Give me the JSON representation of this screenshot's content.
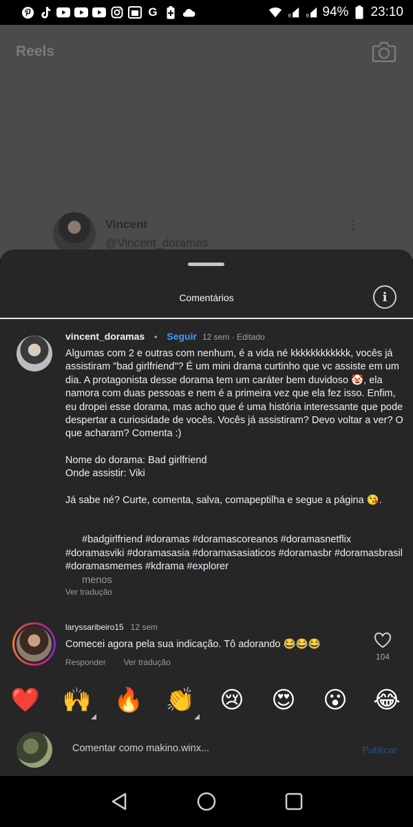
{
  "status_bar": {
    "icons": [
      "pinterest-icon",
      "tiktok-icon",
      "youtube-icon",
      "youtube-icon",
      "youtube-icon",
      "instagram-icon",
      "vpn-icon",
      "google-icon",
      "battery-saver-icon",
      "cloud-icon"
    ],
    "battery": "94%",
    "time": "23:10"
  },
  "background": {
    "title": "Reels",
    "profile_name": "Vincent",
    "profile_handle": "@Vincent_doramas"
  },
  "sheet": {
    "title": "Comentários"
  },
  "caption": {
    "username": "vincent_doramas",
    "follow_label": "Seguir",
    "meta": "12 sem · Editado",
    "paragraph1": "Algumas com 2 e outras com nenhum, é a vida né kkkkkkkkkkkk, vocês já assistiram \"bad girlfriend\"? É um mini drama curtinho que vc assiste em um dia. A protagonista desse dorama tem um caráter bem duvidoso 🤡, ela namora com duas pessoas e nem é a primeira vez que ela fez isso. Enfim, eu dropei esse dorama, mas acho que é uma história interessante que pode despertar a curiosidade de vocês. Vocês já assistiram? Devo voltar a ver? O que acharam? Comenta :)",
    "paragraph2": "Nome do dorama: Bad girlfriend\nOnde assistir: Viki",
    "paragraph3": "Já sabe né? Curte, comenta, salva, comapeptilha e segue a página 😘.",
    "hashtags": "#badgirlfriend #doramas #doramascoreanos #doramasnetflix #doramasviki #doramasasia #doramasasiaticos #doramasbr #doramasbrasil #doramasmemes #kdrama #explorer",
    "less_label": "menos",
    "see_translation": "Ver tradução"
  },
  "comment": {
    "username": "laryssaribeiro15",
    "time": "12 sem",
    "text": "Comecei agora  pela sua indicação. Tô adorando 😂😂😂",
    "reply_label": "Responder",
    "see_translation": "Ver tradução",
    "likes": "104"
  },
  "emoji_bar": [
    "❤️",
    "🙌",
    "🔥",
    "👏",
    "😢",
    "😍",
    "😮",
    "😂"
  ],
  "input": {
    "placeholder": "Comentar como makino.winx...",
    "publish_label": "Publicar"
  },
  "colors": {
    "sheet_bg": "#262626",
    "accent": "#3f9bff",
    "publish_disabled": "#27507a"
  }
}
